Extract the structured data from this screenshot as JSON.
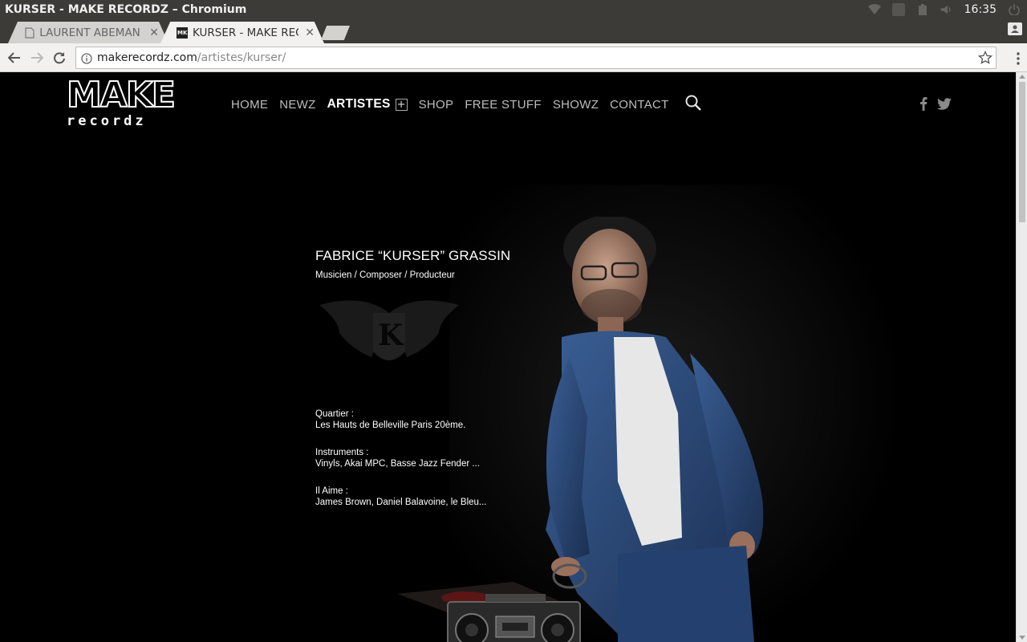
{
  "os": {
    "window_title": "KURSER - MAKE RECORDZ – Chromium",
    "clock": "16:35"
  },
  "browser": {
    "tabs": [
      {
        "label": "LAURENT ABEMAN",
        "active": false
      },
      {
        "label": "KURSER - MAKE REC",
        "active": true
      }
    ],
    "url_host": "makerecordz.com",
    "url_path": "/artistes/kurser/"
  },
  "site": {
    "logo_top": "MAKE",
    "logo_bottom": "recordz",
    "nav": [
      {
        "label": "HOME"
      },
      {
        "label": "NEWZ"
      },
      {
        "label": "ARTISTES",
        "active": true
      },
      {
        "label": "SHOP"
      },
      {
        "label": "FREE STUFF"
      },
      {
        "label": "SHOWZ"
      },
      {
        "label": "CONTACT"
      }
    ]
  },
  "artist": {
    "name": "FABRICE “KURSER” GRASSIN",
    "role": "Musicien / Composer / Producteur",
    "facts": [
      {
        "label": "Quartier :",
        "value": "Les Hauts de Belleville Paris 20ème."
      },
      {
        "label": "Instruments :",
        "value": "Vinyls, Akai MPC, Basse Jazz Fender ..."
      },
      {
        "label": "Il Aime :",
        "value": "James Brown, Daniel Balavoine, le Bleu..."
      }
    ]
  },
  "colors": {
    "page_bg": "#000000",
    "os_bar": "#3c3b37",
    "nav_text": "#bdbdbd",
    "denim": "#2c4a7a"
  },
  "icons": [
    "wifi-icon",
    "keyboard-icon",
    "battery-icon",
    "volume-icon",
    "power-icon",
    "page-icon",
    "make-favicon",
    "close-icon",
    "profile-icon",
    "back-icon",
    "forward-icon",
    "reload-icon",
    "info-icon",
    "star-icon",
    "menu-icon",
    "search-icon",
    "facebook-icon",
    "twitter-icon"
  ]
}
